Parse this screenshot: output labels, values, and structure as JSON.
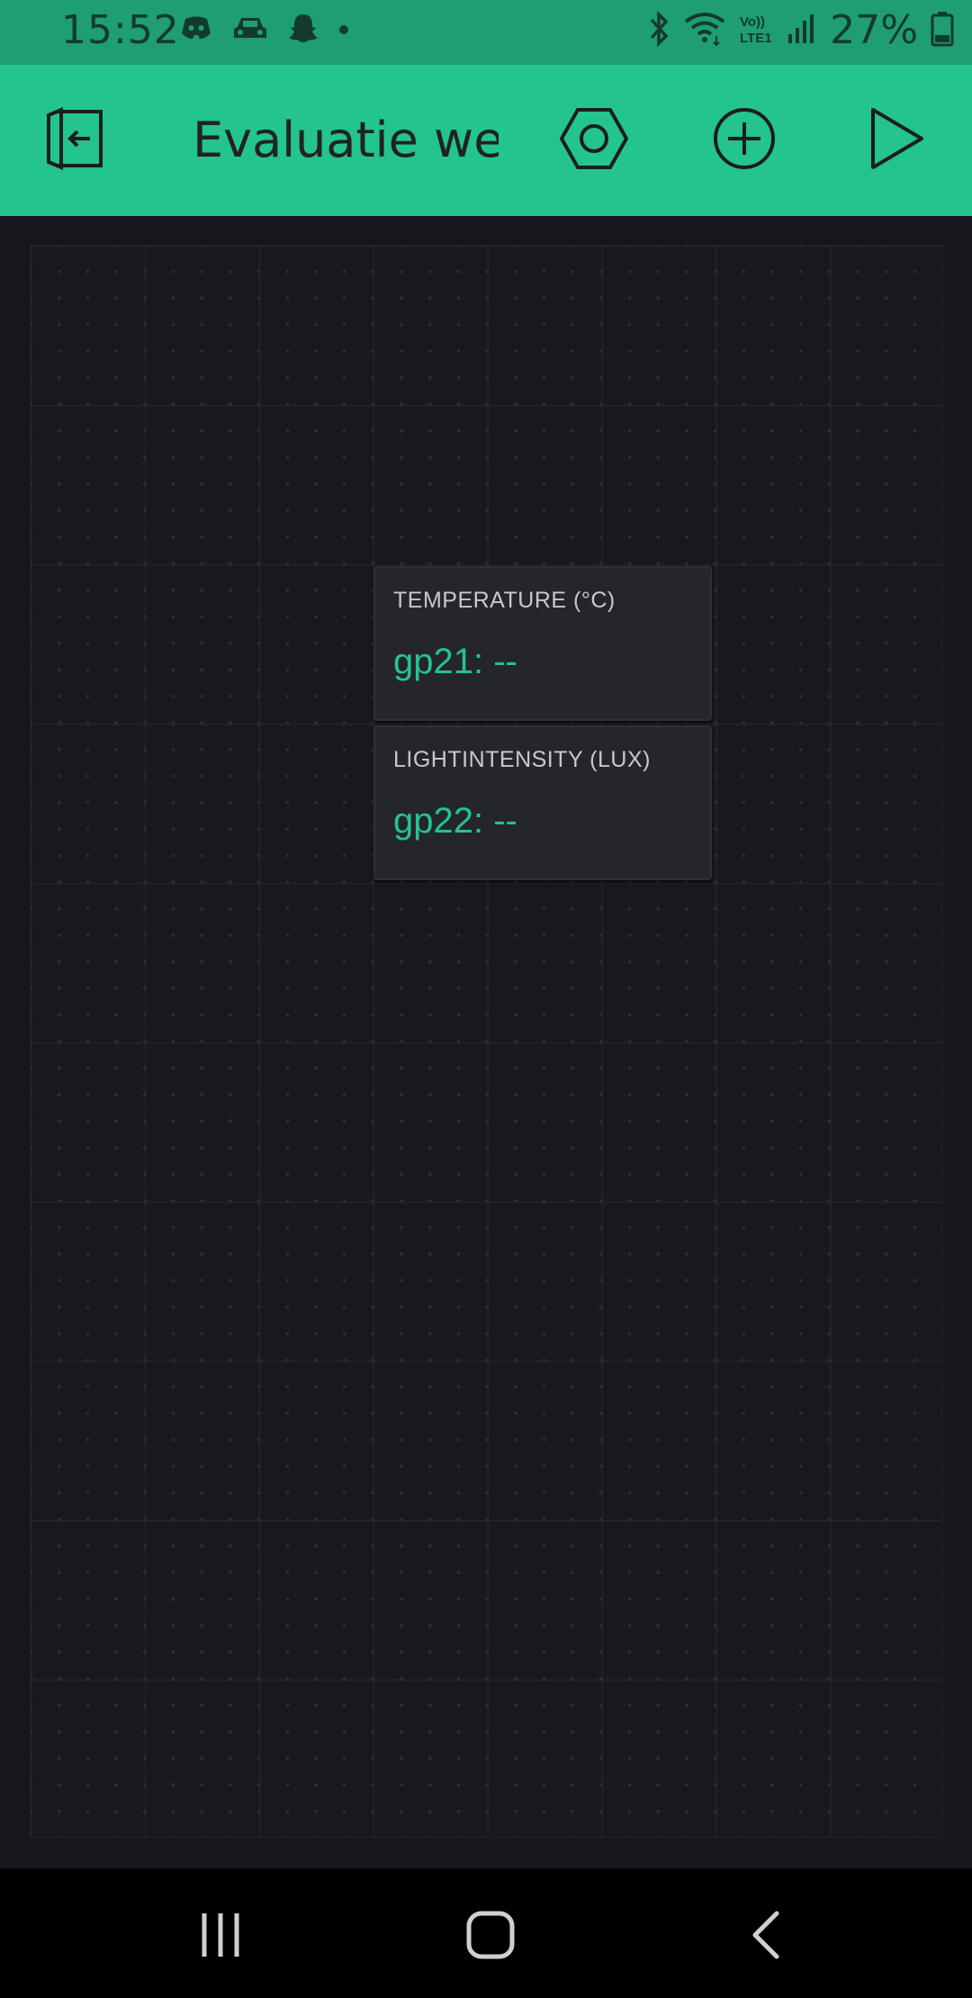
{
  "status_bar": {
    "time": "15:52",
    "battery": "27%",
    "left_icons": [
      "discord-icon",
      "car-icon",
      "snapchat-icon",
      "dot-icon"
    ],
    "right_icons": [
      "bluetooth-icon",
      "wifi-icon",
      "volte-icon",
      "signal-icon",
      "battery-icon"
    ],
    "volte_label": "Vo))\nLTE1"
  },
  "app_bar": {
    "title": "Evaluatie wee",
    "icons": [
      "exit-icon",
      "settings-hexagon-icon",
      "add-icon",
      "play-icon"
    ]
  },
  "widgets": [
    {
      "label": "TEMPERATURE (°C)",
      "value": "gp21: --"
    },
    {
      "label": "LIGHTINTENSITY (LUX)",
      "value": "gp22: --"
    }
  ],
  "nav_bar": {
    "icons": [
      "recents-icon",
      "home-icon",
      "back-icon"
    ]
  },
  "colors": {
    "status_bar": "#1f9e71",
    "app_bar": "#23c48e",
    "accent": "#23c48e",
    "canvas": "#18191e",
    "widget_bg": "#24262c"
  }
}
